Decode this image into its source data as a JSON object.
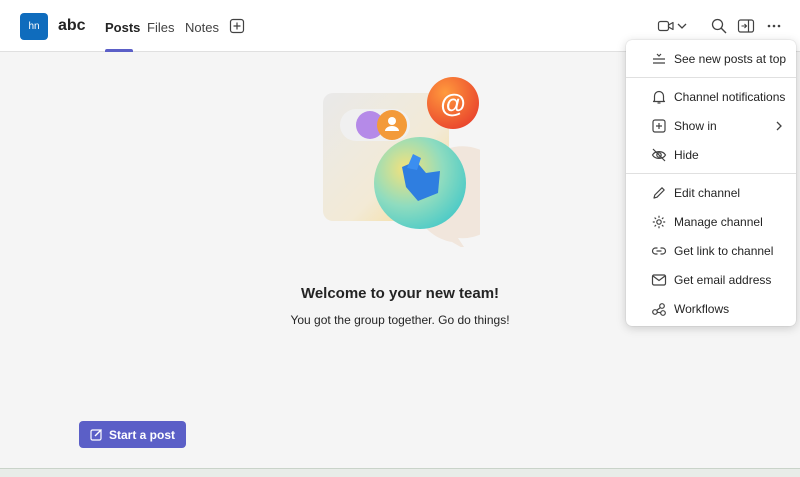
{
  "header": {
    "avatar_initials": "hn",
    "team_name": "abc",
    "tabs": [
      {
        "label": "Posts",
        "active": true
      },
      {
        "label": "Files",
        "active": false
      },
      {
        "label": "Notes",
        "active": false
      }
    ],
    "icons": [
      "add-tab-icon",
      "video-camera-icon",
      "chevron-down-icon",
      "search-icon",
      "side-panel-icon",
      "more-options-icon"
    ]
  },
  "main": {
    "welcome_title": "Welcome to your new team!",
    "welcome_subtitle": "You got the group together. Go do things!",
    "start_post_label": "Start a post"
  },
  "menu": {
    "items": [
      {
        "label": "See new posts at top",
        "icon": "sort-icon"
      },
      {
        "label": "Channel notifications",
        "icon": "bell-icon"
      },
      {
        "label": "Show in",
        "icon": "add-square-icon",
        "submenu": true
      },
      {
        "label": "Hide",
        "icon": "eye-off-icon"
      },
      {
        "label": "Edit channel",
        "icon": "pencil-icon"
      },
      {
        "label": "Manage channel",
        "icon": "gear-icon"
      },
      {
        "label": "Get link to channel",
        "icon": "link-icon"
      },
      {
        "label": "Get email address",
        "icon": "mail-icon"
      },
      {
        "label": "Workflows",
        "icon": "workflows-icon"
      }
    ]
  },
  "colors": {
    "brand_purple": "#5b5fc7",
    "avatar_blue": "#0f6cbd",
    "mention_orange": "#f0552e"
  }
}
